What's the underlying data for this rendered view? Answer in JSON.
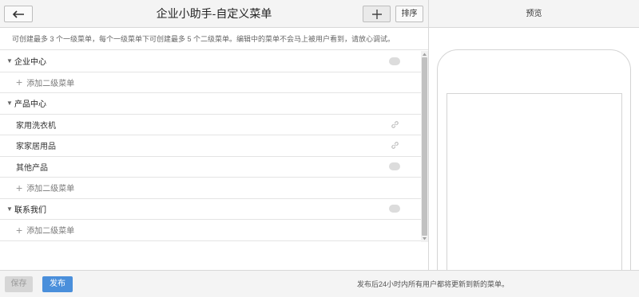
{
  "header": {
    "title": "企业小助手-自定义菜单",
    "sort_label": "排序"
  },
  "notice": "可创建最多 3 个一级菜单，每个一级菜单下可创建最多 5 个二级菜单。编辑中的菜单不会马上被用户看到，请放心调试。",
  "menus": [
    {
      "label": "企业中心",
      "add_label": "添加二级菜单"
    },
    {
      "label": "产品中心",
      "items": [
        "家用洗衣机",
        "家家居用品",
        "其他产品"
      ],
      "add_label": "添加二级菜单"
    },
    {
      "label": "联系我们",
      "add_label": "添加二级菜单"
    }
  ],
  "footer": {
    "save_label": "保存",
    "publish_label": "发布",
    "note": "发布后24小时内所有用户都将更新到新的菜单。"
  },
  "preview": {
    "title": "预览"
  },
  "colors": {
    "publish": "#4a8fdb",
    "toolbar_bg": "#f4f4f4"
  }
}
